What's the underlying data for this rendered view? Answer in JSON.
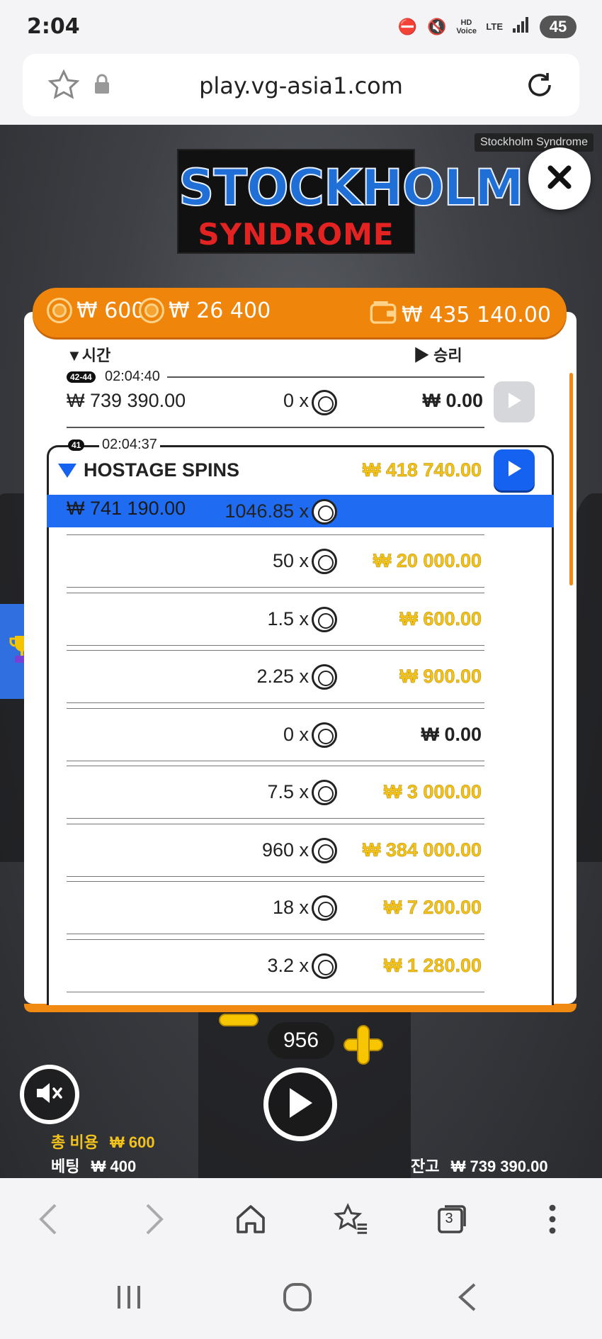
{
  "status_bar": {
    "time": "2:04",
    "battery": "45",
    "network": "LTE",
    "voice": "HD Voice"
  },
  "browser": {
    "url": "play.vg-asia1.com",
    "tab_count": "3"
  },
  "game": {
    "tag": "Stockholm Syndrome",
    "logo_title": "STOCKHOLM",
    "logo_subtitle": "SYNDROME"
  },
  "summary": {
    "bet": "₩ 600",
    "total": "₩ 26 400",
    "wallet": "₩ 435 140.00"
  },
  "history": {
    "col_time": "▼시간",
    "col_win": "▶ 승리",
    "rows": [
      {
        "badge": "42-44",
        "time": "02:04:40",
        "balance": "₩ 739 390.00",
        "multiplier": "0 x",
        "win": "₩ 0.00"
      }
    ],
    "feature": {
      "badge": "41",
      "time": "02:04:37",
      "title": "HOSTAGE SPINS",
      "total_win": "₩ 418 740.00",
      "balance": "₩ 741 190.00",
      "multiplier": "1046.85 x",
      "spins": [
        {
          "multiplier": "50 x",
          "win": "₩ 20 000.00",
          "gold": true
        },
        {
          "multiplier": "1.5 x",
          "win": "₩ 600.00",
          "gold": true
        },
        {
          "multiplier": "2.25 x",
          "win": "₩ 900.00",
          "gold": true
        },
        {
          "multiplier": "0 x",
          "win": "₩ 0.00",
          "gold": false
        },
        {
          "multiplier": "7.5 x",
          "win": "₩ 3 000.00",
          "gold": true
        },
        {
          "multiplier": "960 x",
          "win": "₩ 384 000.00",
          "gold": true
        },
        {
          "multiplier": "18 x",
          "win": "₩ 7 200.00",
          "gold": true
        },
        {
          "multiplier": "3.2 x",
          "win": "₩ 1 280.00",
          "gold": true
        }
      ]
    }
  },
  "controls": {
    "stepper_value": "956",
    "total_cost_label": "총 비용",
    "total_cost": "₩ 600",
    "bet_label": "베팅",
    "bet": "₩ 400",
    "balance_label": "잔고",
    "balance": "₩ 739 390.00"
  },
  "colors": {
    "accent_orange": "#f0850c",
    "highlight_blue": "#1f6cf2",
    "gold_win": "#f3c21a"
  }
}
